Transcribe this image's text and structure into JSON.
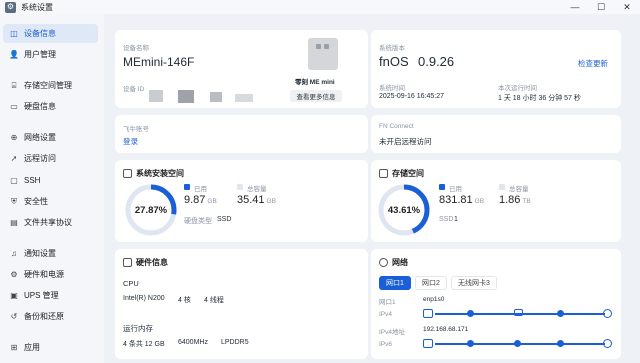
{
  "window": {
    "title": "系统设置",
    "controls": [
      "—",
      "☐",
      "✕"
    ]
  },
  "sidebar": {
    "items": [
      {
        "label": "设备信息",
        "icon": "info-icon",
        "glyph": "◫",
        "active": true
      },
      {
        "label": "用户管理",
        "icon": "user-icon",
        "glyph": "👤"
      },
      {
        "label": "存储空间管理",
        "icon": "storage-icon",
        "glyph": "⌸"
      },
      {
        "label": "硬盘信息",
        "icon": "disk-icon",
        "glyph": "▭"
      },
      {
        "label": "网络设置",
        "icon": "network-icon",
        "glyph": "⊕"
      },
      {
        "label": "远程访问",
        "icon": "remote-icon",
        "glyph": "➚"
      },
      {
        "label": "SSH",
        "icon": "ssh-icon",
        "glyph": "▢"
      },
      {
        "label": "安全性",
        "icon": "shield-icon",
        "glyph": "⛨"
      },
      {
        "label": "文件共享协议",
        "icon": "share-icon",
        "glyph": "▤"
      },
      {
        "label": "通知设置",
        "icon": "bell-icon",
        "glyph": "♫"
      },
      {
        "label": "硬件和电源",
        "icon": "power-icon",
        "glyph": "⚙"
      },
      {
        "label": "UPS 管理",
        "icon": "ups-icon",
        "glyph": "▣"
      },
      {
        "label": "备份和还原",
        "icon": "backup-icon",
        "glyph": "↺"
      },
      {
        "label": "应用",
        "icon": "apps-icon",
        "glyph": "⊞"
      }
    ]
  },
  "device": {
    "name_label": "设备名称",
    "name": "MEmini-146F",
    "id_label": "设备 ID",
    "model": "零刻 ME mini",
    "more_button": "查看更多信息"
  },
  "system": {
    "version_label": "系统版本",
    "os_name": "fnOS",
    "os_version": "0.9.26",
    "check_update": "检查更新",
    "time_label": "系统时间",
    "time_value": "2025-09-16 16:45:27",
    "uptime_label": "本次运行时间",
    "uptime_value": "1 天 18 小时 36 分钟 57 秒"
  },
  "account": {
    "label": "飞牛账号",
    "login": "登录"
  },
  "fn_connect": {
    "label": "FN Connect",
    "status": "未开启远程访问"
  },
  "system_storage": {
    "title": "系统安装空间",
    "percent": 27.87,
    "percent_text": "27.87%",
    "used_label": "已用",
    "used_value": "9.87",
    "used_unit": "GB",
    "total_label": "总容量",
    "total_value": "35.41",
    "total_unit": "GB",
    "disk_type_label": "硬盘类型",
    "disk_type": "SSD",
    "used_color": "#1a5fd7",
    "free_color": "#dfe6f2"
  },
  "storage_space": {
    "title": "存储空间",
    "percent": 43.61,
    "percent_text": "43.61%",
    "used_label": "已用",
    "used_value": "831.81",
    "used_unit": "GB",
    "total_label": "总容量",
    "total_value": "1.86",
    "total_unit": "TB",
    "ssd_label": "SSD",
    "ssd_count": "1",
    "used_color": "#1a5fd7",
    "free_color": "#dfe6f2"
  },
  "hardware": {
    "title": "硬件信息",
    "cpu_label": "CPU",
    "cpu_model": "Intel(R) N200",
    "cpu_cores": "4 核",
    "cpu_threads": "4 线程",
    "mem_label": "运行内存",
    "mem_size": "4 条共 12 GB",
    "mem_freq": "6400MHz",
    "mem_type": "LPDDR5"
  },
  "network": {
    "title": "网络",
    "tabs": [
      "网口1",
      "网口2",
      "无线网卡3"
    ],
    "port_label": "网口1",
    "port_value": "enp1s0",
    "ipv4_label": "IPv4",
    "ipv4_addr_label": "IPv4地址",
    "ipv4_addr": "192.168.68.171",
    "ipv6_label": "IPv6",
    "accent": "#1a5fd7"
  }
}
